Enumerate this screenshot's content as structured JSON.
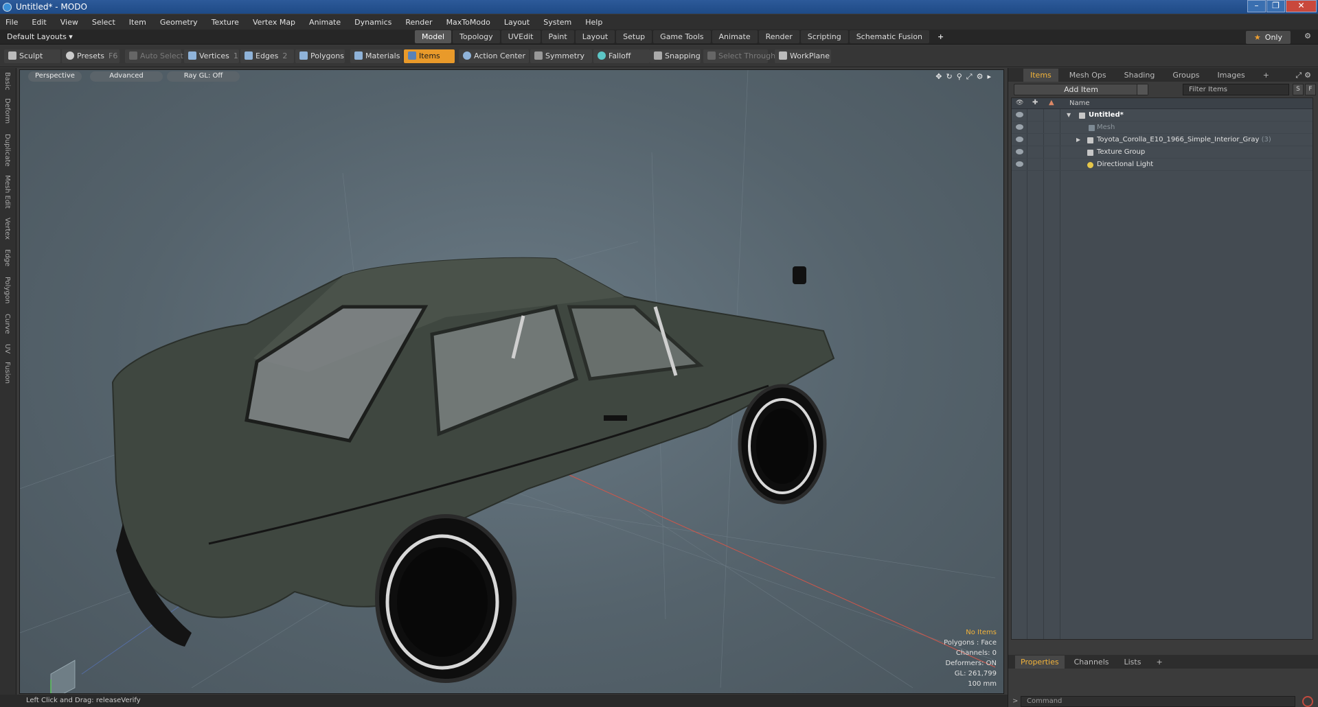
{
  "window": {
    "title": "Untitled* - MODO"
  },
  "menu": [
    "File",
    "Edit",
    "View",
    "Select",
    "Item",
    "Geometry",
    "Texture",
    "Vertex Map",
    "Animate",
    "Dynamics",
    "Render",
    "MaxToModo",
    "Layout",
    "System",
    "Help"
  ],
  "layout": {
    "default_layouts": "Default Layouts ▾",
    "tabs": [
      "Model",
      "Topology",
      "UVEdit",
      "Paint",
      "Layout",
      "Setup",
      "Game Tools",
      "Animate",
      "Render",
      "Scripting",
      "Schematic Fusion"
    ],
    "active_tab": "Model",
    "only_label": "Only"
  },
  "toolbar": {
    "sculpt": "Sculpt",
    "presets": "Presets",
    "presets_key": "F6",
    "auto_select": "Auto Select",
    "vertices": "Vertices",
    "vertices_key": "1",
    "edges": "Edges",
    "edges_key": "2",
    "polygons": "Polygons",
    "materials": "Materials",
    "items": "Items",
    "action_center": "Action Center",
    "symmetry": "Symmetry",
    "falloff": "Falloff",
    "snapping": "Snapping",
    "select_through": "Select Through",
    "workplane": "WorkPlane"
  },
  "left_tabs": [
    "Basic",
    "Deform",
    "Duplicate",
    "Mesh Edit",
    "Vertex",
    "Edge",
    "Polygon",
    "Curve",
    "UV",
    "Fusion"
  ],
  "viewport": {
    "perspective": "Perspective",
    "advanced": "Advanced",
    "raygl": "Ray GL: Off",
    "info": {
      "no_items": "No Items",
      "polygons": "Polygons : Face",
      "channels": "Channels: 0",
      "deformers": "Deformers: ON",
      "gl": "GL: 261,799",
      "scale": "100 mm"
    }
  },
  "status": {
    "text": "Left Click and Drag:   releaseVerify"
  },
  "items_panel": {
    "tabs": [
      "Items",
      "Mesh Ops",
      "Shading",
      "Groups",
      "Images"
    ],
    "active_tab": "Items",
    "add_item": "Add Item",
    "filter_placeholder": "Filter Items",
    "s_btn": "S",
    "f_btn": "F",
    "column_name": "Name",
    "tree": [
      {
        "label": "Untitled*",
        "style": "bold",
        "indent": 0
      },
      {
        "label": "Mesh",
        "style": "grey",
        "indent": 1
      },
      {
        "label": "Toyota_Corolla_E10_1966_Simple_Interior_Gray",
        "count": "(3)",
        "indent": 1
      },
      {
        "label": "Texture Group",
        "indent": 1
      },
      {
        "label": "Directional Light",
        "indent": 1
      }
    ]
  },
  "properties_panel": {
    "tabs": [
      "Properties",
      "Channels",
      "Lists"
    ],
    "active_tab": "Properties",
    "command_placeholder": "Command"
  },
  "colors": {
    "accent": "#e99a2a",
    "highlight_text": "#f2b33a",
    "title_bar": "#1e4a86"
  }
}
